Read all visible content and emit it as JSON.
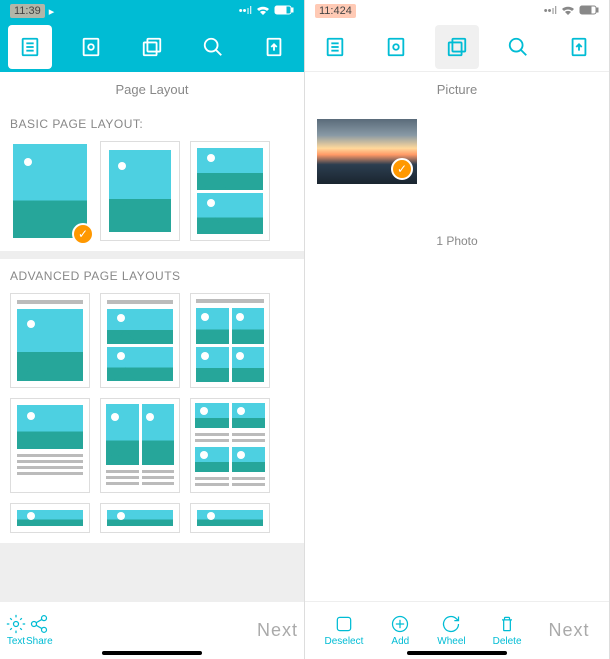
{
  "left": {
    "status": {
      "time": "11:39",
      "location_icon": "▸"
    },
    "page_title": "Page Layout",
    "sections": {
      "basic": {
        "title": "BASIC PAGE LAYOUT:"
      },
      "advanced": {
        "title": "ADVANCED PAGE LAYOUTS"
      }
    },
    "bottom": {
      "text": "Text",
      "share": "Share",
      "next": "Next"
    }
  },
  "right": {
    "status": {
      "time": "11:424"
    },
    "page_title": "Picture",
    "photo_count": "1 Photo",
    "bottom": {
      "deselect": "Deselect",
      "add": "Add",
      "wheel": "Wheel",
      "delete": "Delete",
      "next": "Next"
    }
  },
  "colors": {
    "primary": "#00bcd4",
    "accent": "#ff9800"
  }
}
